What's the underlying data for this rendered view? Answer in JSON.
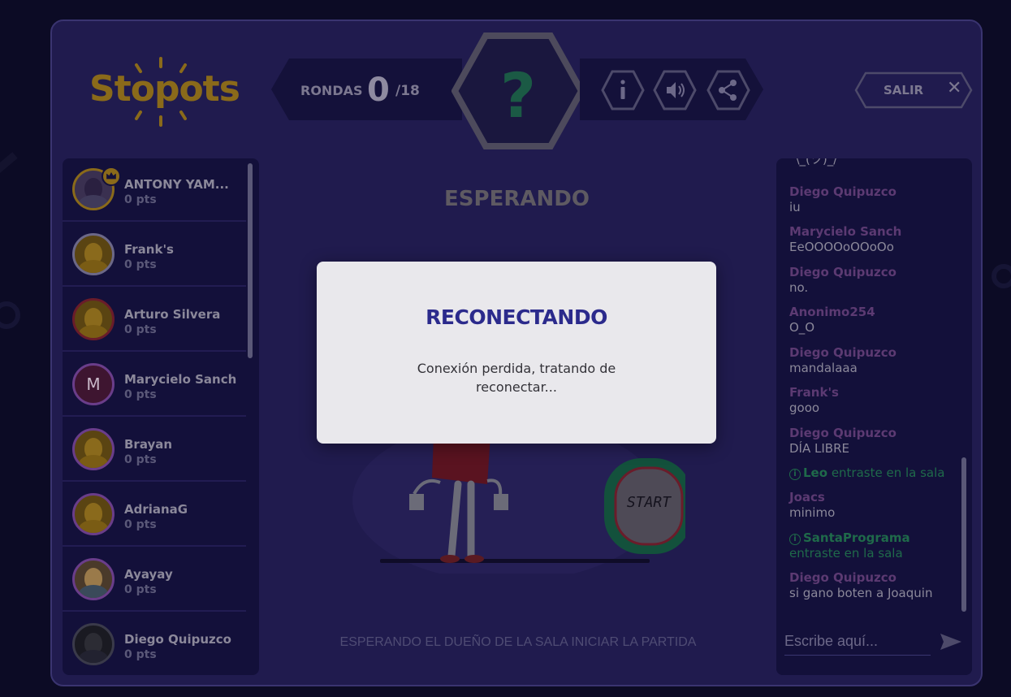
{
  "colors": {
    "background": "#0c0b25",
    "panel": "#201b4e",
    "dark_panel": "#13103a",
    "modal_bg": "#e9e8ec",
    "modal_title": "#2b2a8c",
    "logo": "#8a6a1a",
    "chat_author": "#5c3a72",
    "system_green": "#1f6a4a"
  },
  "header": {
    "logo_text": "Stopots",
    "rounds_label": "RONDAS",
    "rounds_current": "0",
    "rounds_total": "/18",
    "center_icon": "question-mark-icon",
    "buttons": [
      {
        "icon": "info-icon"
      },
      {
        "icon": "sound-icon"
      },
      {
        "icon": "share-icon"
      }
    ],
    "exit_label": "SALIR",
    "exit_icon": "close-icon"
  },
  "players": [
    {
      "name": "ANTONY YAM...",
      "points": "0 pts",
      "crown": true
    },
    {
      "name": "Frank's",
      "points": "0 pts"
    },
    {
      "name": "Arturo Silvera",
      "points": "0 pts"
    },
    {
      "name": "Marycielo Sanch",
      "points": "0 pts",
      "letter": "M"
    },
    {
      "name": "Brayan",
      "points": "0 pts"
    },
    {
      "name": "AdrianaG",
      "points": "0 pts"
    },
    {
      "name": "Ayayay",
      "points": "0 pts"
    },
    {
      "name": "Diego Quipuzco",
      "points": "0 pts"
    }
  ],
  "main": {
    "status_title": "ESPERANDO",
    "start_label": "START",
    "bottom_message": "ESPERANDO EL DUEÑO DE LA SALA INICIAR LA PARTIDA"
  },
  "chat": {
    "partial_top": "¯\\_(ツ)_/¯",
    "messages": [
      {
        "author": "Diego Quipuzco",
        "text": "iu"
      },
      {
        "author": "Marycielo Sanch",
        "text": "EeOOOOoOOoOo"
      },
      {
        "author": "Diego Quipuzco",
        "text": "no."
      },
      {
        "author": "Anonimo254",
        "text": "O_O"
      },
      {
        "author": "Diego Quipuzco",
        "text": "mandalaaa"
      },
      {
        "author": "Frank's",
        "text": "gooo"
      },
      {
        "author": "Diego Quipuzco",
        "text": "DÍA LIBRE"
      },
      {
        "system_name": "Leo",
        "system_text": " entraste en la sala"
      },
      {
        "author": "Joacs",
        "text": "minimo"
      },
      {
        "system_name": "SantaPrograma",
        "system_text": "entraste en la sala"
      },
      {
        "author": "Diego Quipuzco",
        "text": "si gano boten a Joaquin"
      }
    ],
    "input_placeholder": "Escribe aquí...",
    "send_icon": "send-icon"
  },
  "modal": {
    "title": "RECONECTANDO",
    "text": "Conexión perdida, tratando de reconectar..."
  }
}
